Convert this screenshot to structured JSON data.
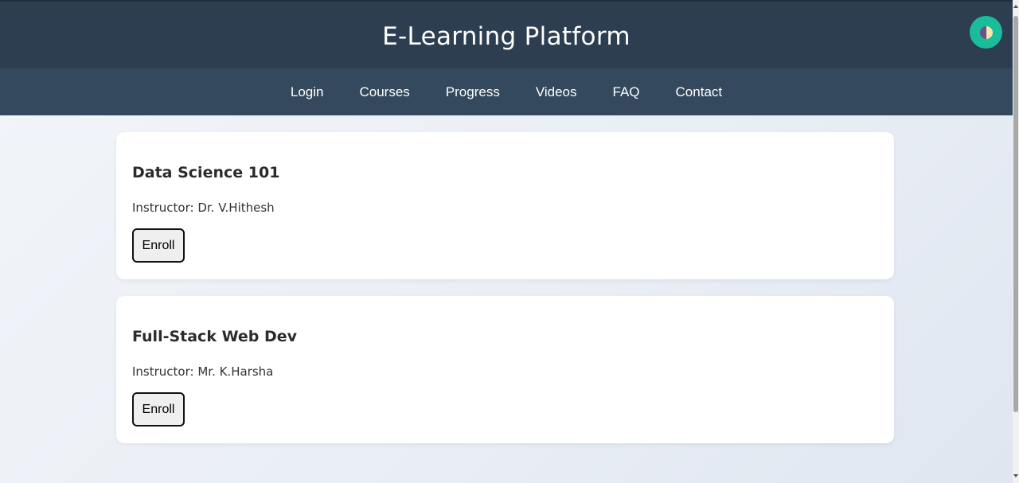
{
  "header": {
    "title": "E-Learning Platform",
    "theme_toggle_icon": "half-moon-icon"
  },
  "nav": {
    "items": [
      {
        "label": "Login"
      },
      {
        "label": "Courses"
      },
      {
        "label": "Progress"
      },
      {
        "label": "Videos"
      },
      {
        "label": "FAQ"
      },
      {
        "label": "Contact"
      }
    ]
  },
  "courses": [
    {
      "title": "Data Science 101",
      "instructor": "Instructor: Dr. V.Hithesh",
      "button_label": "Enroll"
    },
    {
      "title": "Full-Stack Web Dev",
      "instructor": "Instructor: Mr. K.Harsha",
      "button_label": "Enroll"
    }
  ],
  "colors": {
    "header_bg": "#2c3e50",
    "nav_bg": "#34495e",
    "accent": "#1abc9c"
  }
}
